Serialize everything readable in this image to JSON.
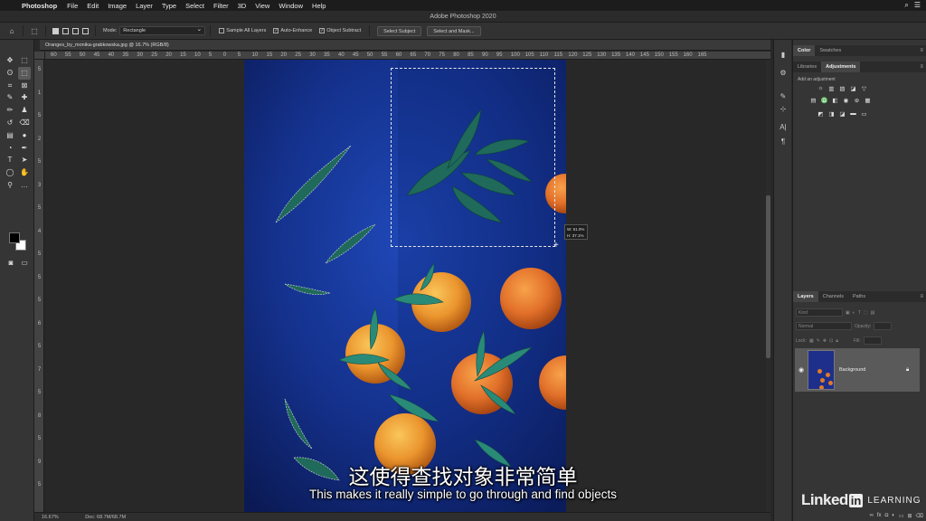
{
  "menubar": {
    "app_name": "Photoshop",
    "items": [
      "File",
      "Edit",
      "Image",
      "Layer",
      "Type",
      "Select",
      "Filter",
      "3D",
      "View",
      "Window",
      "Help"
    ]
  },
  "window_title": "Adobe Photoshop 2020",
  "options_bar": {
    "mode_label": "Mode:",
    "mode_value": "Rectangle",
    "sample_all_layers": "Sample All Layers",
    "auto_enhance": "Auto-Enhance",
    "object_subtract": "Object Subtract",
    "select_subject": "Select Subject",
    "select_and_mask": "Select and Mask..."
  },
  "document_tab": "Oranges_by_monika-grabkowska.jpg @ 16.7% (RGB/8)",
  "rulers": {
    "top": [
      "60",
      "55",
      "50",
      "45",
      "40",
      "35",
      "30",
      "25",
      "20",
      "15",
      "10",
      "5",
      "0",
      "5",
      "10",
      "15",
      "20",
      "25",
      "30",
      "35",
      "40",
      "45",
      "50",
      "55",
      "60",
      "65",
      "70",
      "75",
      "80",
      "85",
      "90",
      "95",
      "100",
      "105",
      "110",
      "115",
      "120",
      "125",
      "130",
      "135",
      "140",
      "145",
      "150",
      "155",
      "160",
      "165"
    ],
    "left": [
      "5",
      "1",
      "5",
      "2",
      "5",
      "3",
      "5",
      "4",
      "5",
      "5",
      "5",
      "6",
      "5",
      "7",
      "5",
      "8",
      "5",
      "9",
      "5"
    ]
  },
  "measure": {
    "w": "W: 51.0%",
    "h": "H: 37.1%"
  },
  "status": {
    "zoom": "16.67%",
    "doc": "Doc: 68.7M/68.7M"
  },
  "panels": {
    "color_tabs": [
      "Color",
      "Swatches"
    ],
    "adjust_tabs": [
      "Libraries",
      "Adjustments"
    ],
    "add_adjustment": "Add an adjustment",
    "layers_tabs": [
      "Layers",
      "Channels",
      "Paths"
    ],
    "kind_placeholder": "Kind",
    "blend_mode": "Normal",
    "opacity_label": "Opacity:",
    "lock_label": "Lock:",
    "fill_label": "Fill:",
    "layer_name": "Background"
  },
  "subtitles": {
    "chinese": "这使得查找对象非常简单",
    "english": "This makes it really simple to go through and find objects"
  },
  "logo": {
    "linked": "Linked",
    "in": "in",
    "learning": "LEARNING"
  }
}
